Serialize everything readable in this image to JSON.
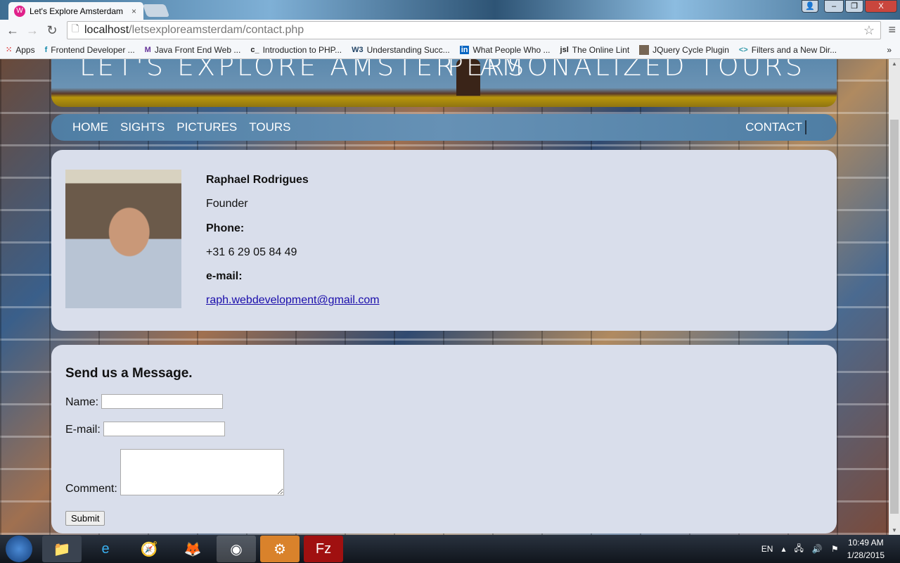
{
  "browser": {
    "tab_title": "Let's Explore Amsterdam",
    "url_host": "localhost",
    "url_path": "/letsexploreamsterdam/contact.php",
    "bookmarks": [
      "Apps",
      "Frontend Developer ...",
      "Java Front End Web ...",
      "Introduction to PHP...",
      "Understanding Succ...",
      "What People Who ...",
      "The Online Lint",
      "JQuery Cycle Plugin",
      "Filters and a New Dir..."
    ],
    "bookmark_icons": [
      "apps",
      "f",
      "M",
      "c_",
      "W3",
      "in",
      "jsl",
      "img",
      "<>"
    ]
  },
  "banner": {
    "title_left": "LET'S EXPLORE AMSTERDAM",
    "title_right": "PERSONALIZED TOURS"
  },
  "nav": {
    "items": [
      "HOME",
      "SIGHTS",
      "PICTURES",
      "TOURS"
    ],
    "contact": "CONTACT"
  },
  "contact": {
    "name": "Raphael Rodrigues",
    "role": "Founder",
    "phone_label": "Phone:",
    "phone": "+31 6 29 05 84 49",
    "email_label": "e-mail:",
    "email": "raph.webdevelopment@gmail.com"
  },
  "form": {
    "title": "Send us a Message.",
    "name_label": "Name:",
    "email_label": "E-mail:",
    "comment_label": "Comment:",
    "submit": "Submit"
  },
  "taskbar": {
    "lang": "EN",
    "time": "10:49 AM",
    "date": "1/28/2015"
  }
}
